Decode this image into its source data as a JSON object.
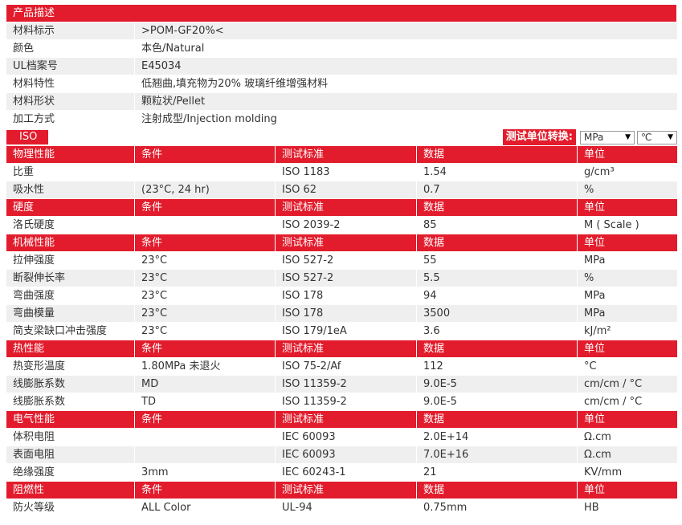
{
  "desc": {
    "title": "产品描述",
    "rows": [
      {
        "label": "材料标示",
        "value": ">POM-GF20%<"
      },
      {
        "label": "颜色",
        "value": "本色/Natural"
      },
      {
        "label": "UL档案号",
        "value": "E45034"
      },
      {
        "label": "材料特性",
        "value": "低翘曲,填充物为20% 玻璃纤维增强材料"
      },
      {
        "label": "材料形状",
        "value": "颗粒状/Pellet"
      },
      {
        "label": "加工方式",
        "value": "注射成型/Injection molding"
      }
    ]
  },
  "iso": {
    "badge": "ISO",
    "unit_label": "测试单位转换:",
    "pressure_unit": "MPa",
    "temp_unit": "℃"
  },
  "sections": [
    {
      "header": [
        "物理性能",
        "条件",
        "测试标准",
        "数据",
        "单位"
      ],
      "rows": [
        [
          "比重",
          "",
          "ISO 1183",
          "1.54",
          "g/cm³"
        ],
        [
          "吸水性",
          "(23°C, 24 hr)",
          "ISO 62",
          "0.7",
          "%"
        ]
      ]
    },
    {
      "header": [
        "硬度",
        "条件",
        "测试标准",
        "数据",
        "单位"
      ],
      "rows": [
        [
          "洛氏硬度",
          "",
          "ISO 2039-2",
          "85",
          "M ( Scale )"
        ]
      ]
    },
    {
      "header": [
        "机械性能",
        "条件",
        "测试标准",
        "数据",
        "单位"
      ],
      "rows": [
        [
          "拉伸强度",
          "23°C",
          "ISO 527-2",
          "55",
          "MPa"
        ],
        [
          "断裂伸长率",
          "23°C",
          "ISO 527-2",
          "5.5",
          "%"
        ],
        [
          "弯曲强度",
          "23°C",
          "ISO 178",
          "94",
          "MPa"
        ],
        [
          "弯曲模量",
          "23°C",
          "ISO 178",
          "3500",
          "MPa"
        ],
        [
          "简支梁缺口冲击强度",
          "23°C",
          "ISO 179/1eA",
          "3.6",
          "kJ/m²"
        ]
      ]
    },
    {
      "header": [
        "热性能",
        "条件",
        "测试标准",
        "数据",
        "单位"
      ],
      "rows": [
        [
          "热变形温度",
          "1.80MPa 未退火",
          "ISO 75-2/Af",
          "112",
          "°C"
        ],
        [
          "线膨胀系数",
          "MD",
          "ISO 11359-2",
          "9.0E-5",
          "cm/cm / °C"
        ],
        [
          "线膨胀系数",
          "TD",
          "ISO 11359-2",
          "9.0E-5",
          "cm/cm / °C"
        ]
      ]
    },
    {
      "header": [
        "电气性能",
        "条件",
        "测试标准",
        "数据",
        "单位"
      ],
      "rows": [
        [
          "体积电阻",
          "",
          "IEC 60093",
          "2.0E+14",
          "Ω.cm"
        ],
        [
          "表面电阻",
          "",
          "IEC 60093",
          "7.0E+16",
          "Ω.cm"
        ],
        [
          "绝缘强度",
          "3mm",
          "IEC 60243-1",
          "21",
          "KV/mm"
        ]
      ]
    },
    {
      "header": [
        "阻燃性",
        "条件",
        "测试标准",
        "数据",
        "单位"
      ],
      "rows": [
        [
          "防火等级",
          "ALL Color",
          "UL-94",
          "0.75mm",
          "HB"
        ]
      ]
    }
  ]
}
